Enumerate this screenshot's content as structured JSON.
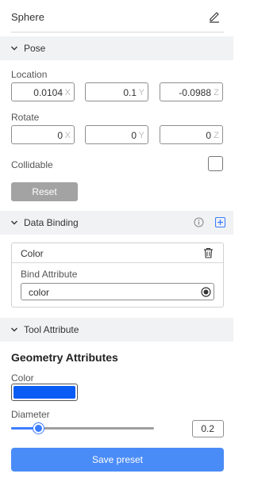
{
  "header": {
    "title": "Sphere",
    "edit_icon": "pencil-icon"
  },
  "pose": {
    "title": "Pose",
    "location": {
      "label": "Location",
      "x": "0.0104",
      "y": "0.1",
      "z": "-0.0988"
    },
    "rotate": {
      "label": "Rotate",
      "x": "0",
      "y": "0",
      "z": "0"
    },
    "axis_labels": {
      "x": "X",
      "y": "Y",
      "z": "Z"
    },
    "collidable_label": "Collidable",
    "collidable_checked": false,
    "reset_label": "Reset"
  },
  "data_binding": {
    "title": "Data Binding",
    "info_icon": "info-icon",
    "add_icon": "plus-square-icon",
    "card": {
      "name": "Color",
      "bind_label": "Bind Attribute",
      "bind_value": "color"
    }
  },
  "tool_attribute": {
    "title": "Tool Attribute",
    "geometry_title": "Geometry Attributes",
    "color_label": "Color",
    "color_value": "#0a5cf5",
    "diameter_label": "Diameter",
    "diameter_value": "0.2",
    "diameter_slider_fraction": 0.19,
    "save_label": "Save preset"
  },
  "colors": {
    "accent": "#4a8cf7",
    "section_bg": "#f1f2f4",
    "reset_bg": "#a3a3a3"
  }
}
